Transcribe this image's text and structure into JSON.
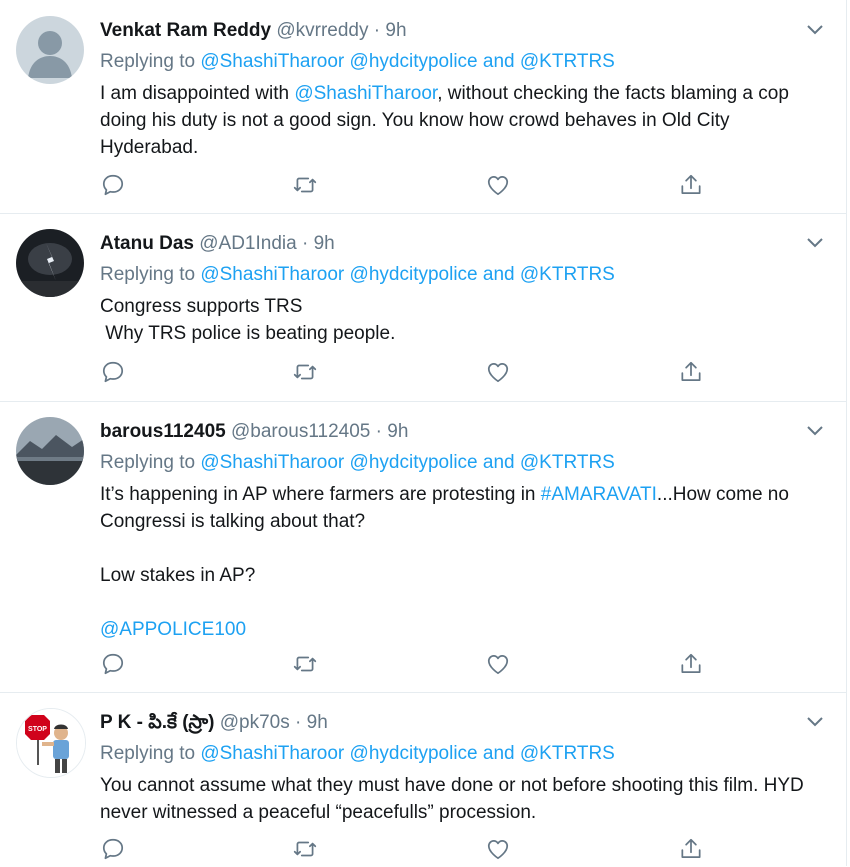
{
  "tweets": [
    {
      "name": "Venkat Ram Reddy",
      "handle": "@kvrreddy",
      "sep": " · ",
      "time": "9h",
      "replying_prefix": "Replying to ",
      "replying": [
        "@ShashiTharoor",
        "@hydcitypolice",
        "and",
        "@KTRTRS"
      ],
      "body": {
        "pre": "I am disappointed with ",
        "mention": "@ShashiTharoor",
        "post": ", without checking the facts blaming a cop doing his duty is not a good sign. You know how crowd behaves in Old City Hyderabad."
      }
    },
    {
      "name": "Atanu Das",
      "handle": "@AD1India",
      "sep": " · ",
      "time": "9h",
      "replying_prefix": "Replying to ",
      "replying": [
        "@ShashiTharoor",
        "@hydcitypolice",
        "and",
        "@KTRTRS"
      ],
      "body": {
        "line1": "Congress supports TRS",
        "line2": " Why TRS police is beating people."
      }
    },
    {
      "name": "barous112405",
      "handle": "@barous112405",
      "sep": " · ",
      "time": "9h",
      "replying_prefix": "Replying to ",
      "replying": [
        "@ShashiTharoor",
        "@hydcitypolice",
        "and",
        "@KTRTRS"
      ],
      "body": {
        "pre": "It’s happening in AP where farmers are protesting in ",
        "hashtag": "#AMARAVATI",
        "post": "...How come no Congressi is talking about that?",
        "para2": "Low stakes in AP?",
        "mention": "@APPOLICE100"
      }
    },
    {
      "name": "P K - పి.కే (స్రా)",
      "handle": "@pk70s",
      "sep": " · ",
      "time": "9h",
      "replying_prefix": "Replying to ",
      "replying": [
        "@ShashiTharoor",
        "@hydcitypolice",
        "and",
        "@KTRTRS"
      ],
      "body": {
        "text": "You cannot assume what they must have done or not before shooting this film. HYD never witnessed a peaceful “peacefulls” procession."
      },
      "avatar_sign": "STOP"
    }
  ],
  "colors": {
    "link": "#1da1f2",
    "muted": "#657786",
    "text": "#14171a",
    "divider": "#e6ecf0"
  },
  "icons": [
    "reply-icon",
    "retweet-icon",
    "like-icon",
    "share-icon",
    "chevron-down-icon"
  ]
}
